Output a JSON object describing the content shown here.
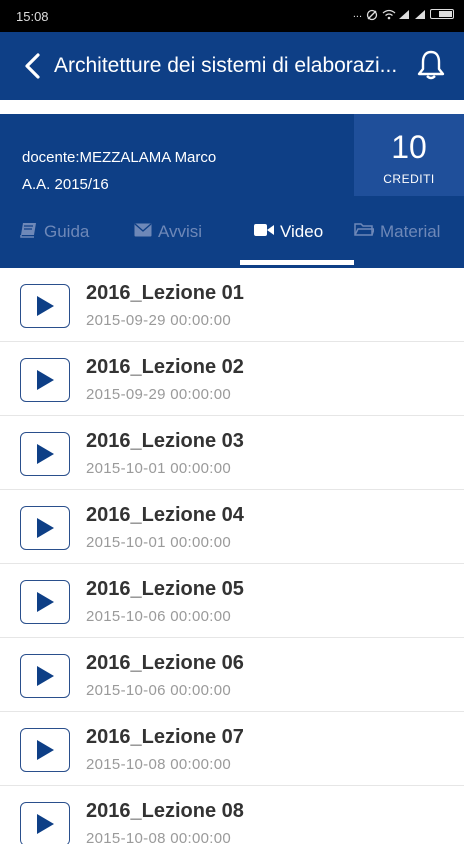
{
  "status_bar": {
    "time": "15:08",
    "indicators": "..."
  },
  "app_bar": {
    "title": "Architetture dei sistemi di elaborazi..."
  },
  "course": {
    "teacher": "docente:MEZZALAMA Marco",
    "year": "A.A. 2015/16",
    "credits_value": "10",
    "credits_label": "CREDITI"
  },
  "tabs": [
    {
      "label": "Guida",
      "icon": "book-icon",
      "active": false
    },
    {
      "label": "Avvisi",
      "icon": "envelope-icon",
      "active": false
    },
    {
      "label": "Video",
      "icon": "video-camera-icon",
      "active": true
    },
    {
      "label": "Material",
      "icon": "folder-icon",
      "active": false
    }
  ],
  "videos": [
    {
      "title": "2016_Lezione 01",
      "date": "2015-09-29 00:00:00"
    },
    {
      "title": "2016_Lezione 02",
      "date": "2015-09-29 00:00:00"
    },
    {
      "title": "2016_Lezione 03",
      "date": "2015-10-01 00:00:00"
    },
    {
      "title": "2016_Lezione 04",
      "date": "2015-10-01 00:00:00"
    },
    {
      "title": "2016_Lezione 05",
      "date": "2015-10-06 00:00:00"
    },
    {
      "title": "2016_Lezione 06",
      "date": "2015-10-06 00:00:00"
    },
    {
      "title": "2016_Lezione 07",
      "date": "2015-10-08 00:00:00"
    },
    {
      "title": "2016_Lezione 08",
      "date": "2015-10-08 00:00:00"
    }
  ],
  "colors": {
    "primary": "#0e3f86",
    "credits_bg": "#1f4f9a",
    "tab_inactive": "#6e88b8"
  }
}
